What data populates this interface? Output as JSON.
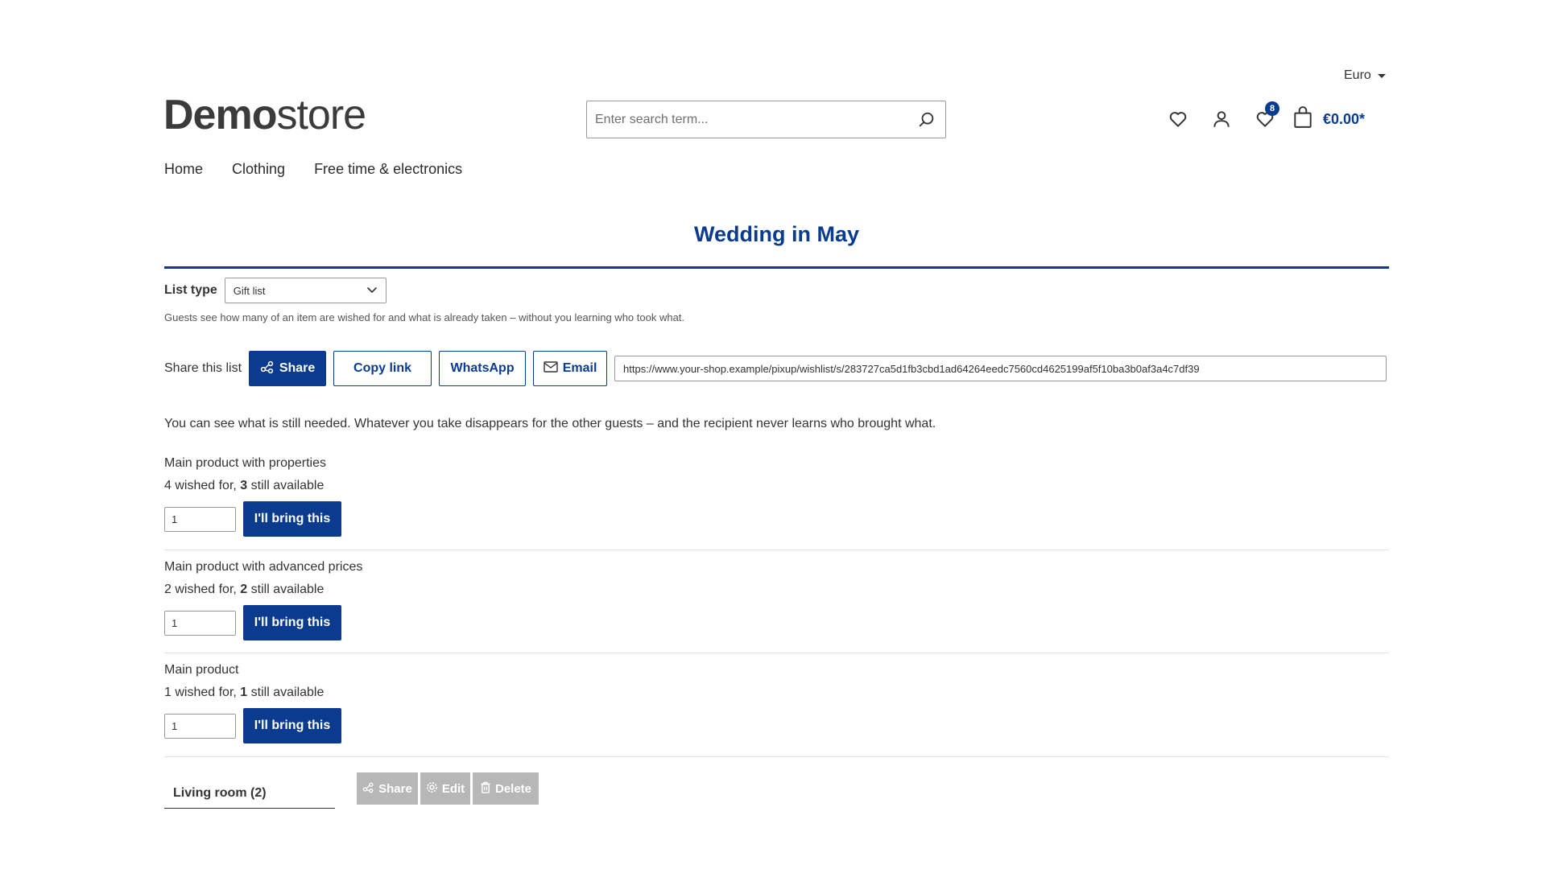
{
  "topbar": {
    "currency": "Euro"
  },
  "header": {
    "logo_bold": "Demo",
    "logo_light": "store",
    "search_placeholder": "Enter search term...",
    "wishlist_badge": "8",
    "cart_total": "€0.00*"
  },
  "nav": {
    "items": [
      "Home",
      "Clothing",
      "Free time & electronics"
    ]
  },
  "page": {
    "title": "Wedding in May",
    "list_type_label": "List type",
    "list_type_value": "Gift list",
    "hint": "Guests see how many of an item are wished for and what is already taken – without you learning who took what.",
    "share_label": "Share this list",
    "share_button": "Share",
    "copy_button": "Copy link",
    "whatsapp_button": "WhatsApp",
    "email_button": "Email",
    "share_url": "https://www.your-shop.example/pixup/wishlist/s/283727ca5d1fb3cbd1ad64264eedc7560cd4625199af5f10ba3b0af3a4c7df39",
    "intro": "You can see what is still needed. Whatever you take disappears for the other guests – and the recipient never learns who brought what."
  },
  "items": [
    {
      "name": "Main product with properties",
      "wished": "4",
      "available": "3",
      "qty": "1",
      "button": "I'll bring this"
    },
    {
      "name": "Main product with advanced prices",
      "wished": "2",
      "available": "2",
      "qty": "1",
      "button": "I'll bring this"
    },
    {
      "name": "Main product",
      "wished": "1",
      "available": "1",
      "qty": "1",
      "button": "I'll bring this"
    }
  ],
  "text_parts": {
    "wished_for": "wished for,",
    "still_available": "still available"
  },
  "tabs": {
    "living_room": "Living room (2)",
    "share": "Share",
    "edit": "Edit",
    "delete": "Delete"
  },
  "colors": {
    "accent": "#0b3b8f",
    "muted_button": "#b7b7b7"
  }
}
